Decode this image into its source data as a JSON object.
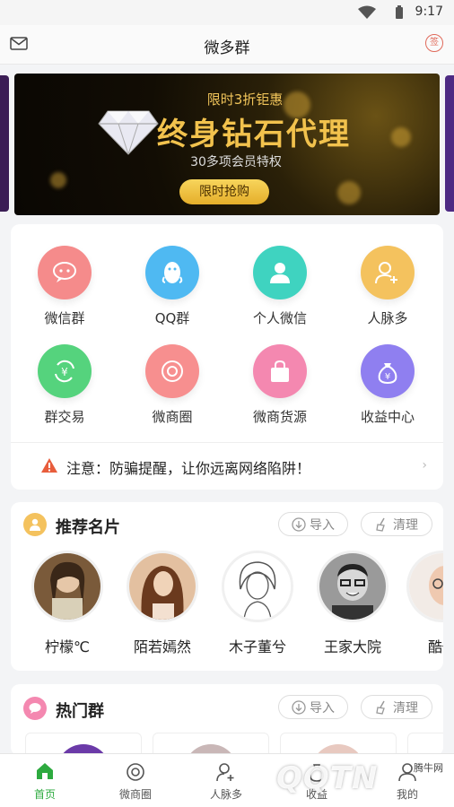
{
  "status": {
    "time": "9:17"
  },
  "nav": {
    "title": "微多群",
    "sign_label": "签"
  },
  "banner": {
    "subtitle": "限时3折钜惠",
    "headline": "终身钻石代理",
    "desc": "30多项会员特权",
    "button": "限时抢购"
  },
  "grid": [
    {
      "label": "微信群",
      "icon": "chat-bubble-icon",
      "color": "#f58b8b"
    },
    {
      "label": "QQ群",
      "icon": "qq-penguin-icon",
      "color": "#4fb9f2"
    },
    {
      "label": "个人微信",
      "icon": "person-icon",
      "color": "#3fd3c0"
    },
    {
      "label": "人脉多",
      "icon": "person-add-icon",
      "color": "#f4c25e"
    },
    {
      "label": "群交易",
      "icon": "yuan-exchange-icon",
      "color": "#55d37d"
    },
    {
      "label": "微商圈",
      "icon": "aperture-icon",
      "color": "#f78f8f"
    },
    {
      "label": "微商货源",
      "icon": "bag-icon",
      "color": "#f488b0"
    },
    {
      "label": "收益中心",
      "icon": "money-bag-icon",
      "color": "#8f7ff0"
    }
  ],
  "notice": {
    "text": "注意：防骗提醒，让你远离网络陷阱！"
  },
  "recommend": {
    "title": "推荐名片",
    "import_label": "导入",
    "clear_label": "清理",
    "people": [
      {
        "name": "柠檬℃"
      },
      {
        "name": "陌若嫣然"
      },
      {
        "name": "木子董兮"
      },
      {
        "name": "王家大院"
      },
      {
        "name": "酷似"
      }
    ]
  },
  "hot": {
    "title": "热门群",
    "import_label": "导入",
    "clear_label": "清理"
  },
  "tabs": [
    {
      "label": "首页",
      "icon": "home-icon",
      "active": true
    },
    {
      "label": "微商圈",
      "icon": "aperture-icon",
      "active": false
    },
    {
      "label": "人脉多",
      "icon": "person-add-icon",
      "active": false
    },
    {
      "label": "收益",
      "icon": "money-bag-icon",
      "active": false
    },
    {
      "label": "我的",
      "icon": "user-icon",
      "active": false
    }
  ],
  "watermark": {
    "big": "QQTN",
    "small": "腾牛网"
  }
}
